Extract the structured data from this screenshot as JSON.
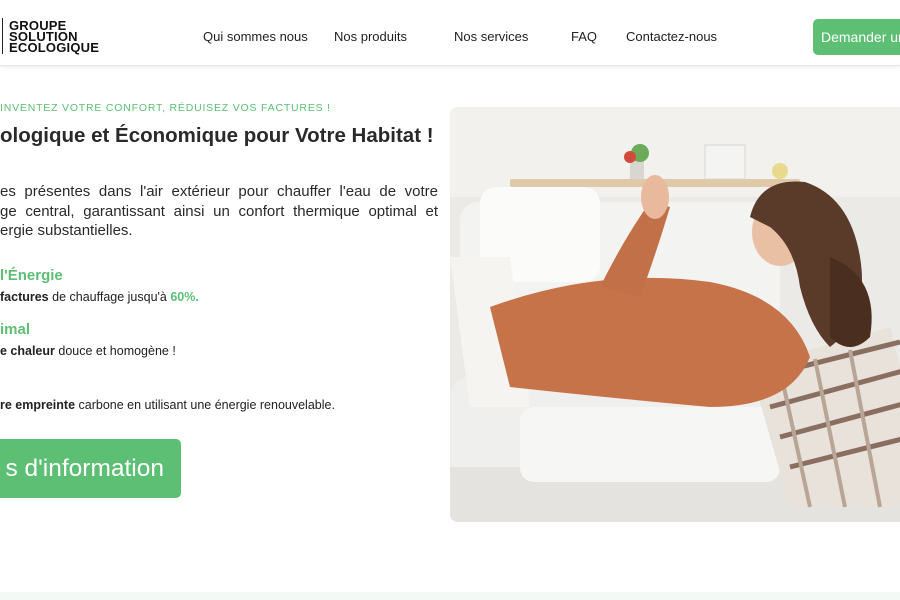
{
  "brand": {
    "logo_lines": [
      "GROUPE",
      "SOLUTION",
      "ECOLOGIQUE"
    ]
  },
  "nav": {
    "items": [
      "Qui sommes nous",
      "Nos produits",
      "Nos services",
      "FAQ",
      "Contactez-nous"
    ],
    "cta_label": "Demander un"
  },
  "hero": {
    "eyebrow": "INVENTEZ VOTRE CONFORT, RÉDUISEZ VOS FACTURES !",
    "title": "ologique et Économique pour Votre Habitat !",
    "description_lines": [
      "es présentes dans l'air extérieur pour chauffer l'eau de votre",
      "ge central, garantissant ainsi un confort thermique optimal et",
      "ergie substantielles."
    ],
    "benefits": [
      {
        "title": "l'Énergie",
        "bold": "factures",
        "text": " de chauffage jusqu'à ",
        "highlight": "60%."
      },
      {
        "title": "imal",
        "bold": "e chaleur",
        "text": " douce et homogène !"
      },
      {
        "title": "",
        "bold": "re empreinte",
        "text": " carbone en utilisant une énergie renouvelable."
      }
    ],
    "button_label": "s d'information"
  },
  "colors": {
    "accent": "#5cbf73",
    "text": "#222222"
  }
}
